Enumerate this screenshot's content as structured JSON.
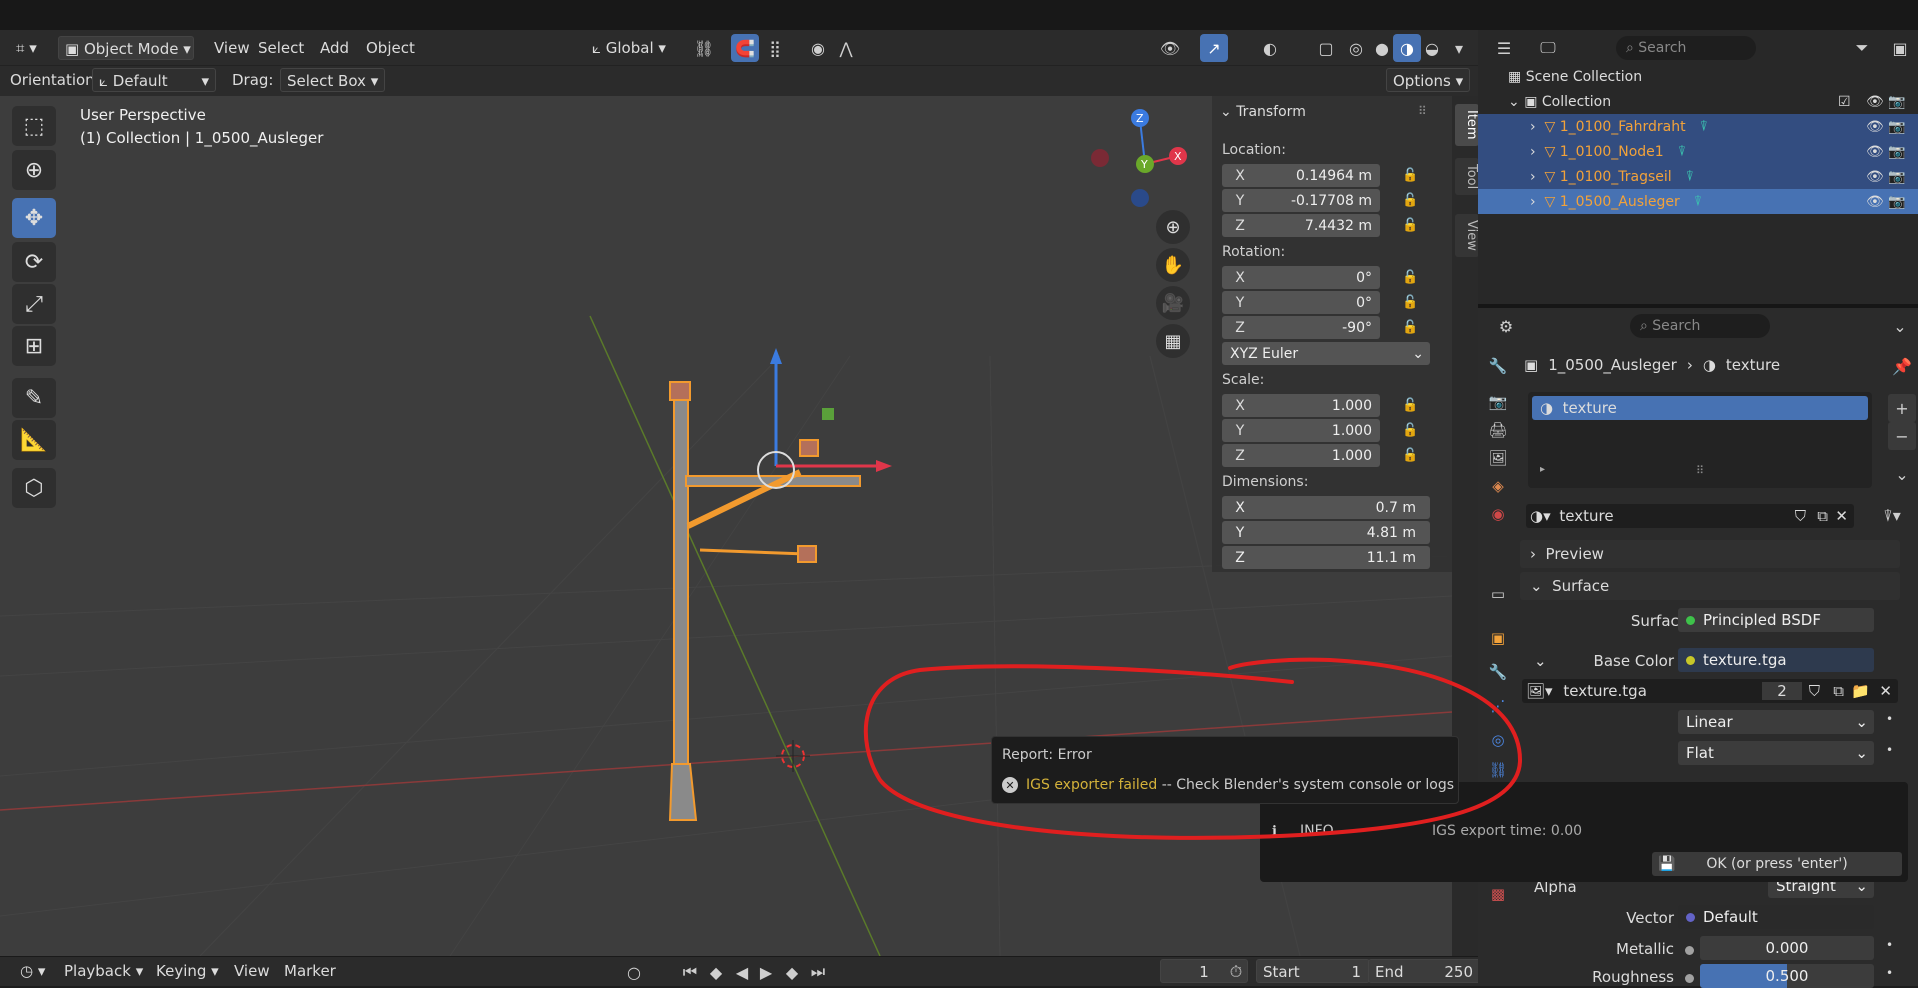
{
  "colors": {
    "accent": "#4772b3",
    "object_orange": "#f2a23a",
    "error_yellow": "#d4b23a",
    "annotation_red": "#e01f1f"
  },
  "header": {
    "editor_type_icon": "grid-icon",
    "mode": "Object Mode",
    "menus": [
      "View",
      "Select",
      "Add",
      "Object"
    ],
    "transform_orientation": "Global",
    "shading_icons": [
      "wireframe-icon",
      "solid-icon",
      "material-icon",
      "rendered-icon"
    ]
  },
  "tool_header": {
    "orientation_label": "Orientation:",
    "orientation_value": "Default",
    "drag_label": "Drag:",
    "drag_value": "Select Box",
    "options_label": "Options"
  },
  "viewport": {
    "perspective": "User Perspective",
    "context": "(1) Collection | 1_0500_Ausleger",
    "gizmo_axes": [
      "X",
      "Y",
      "Z"
    ]
  },
  "npanel": {
    "tabs": [
      "Item",
      "Tool",
      "View"
    ],
    "panel_title": "Transform",
    "location_label": "Location:",
    "location": [
      {
        "axis": "X",
        "value": "0.14964 m"
      },
      {
        "axis": "Y",
        "value": "-0.17708 m"
      },
      {
        "axis": "Z",
        "value": "7.4432 m"
      }
    ],
    "rotation_label": "Rotation:",
    "rotation": [
      {
        "axis": "X",
        "value": "0°"
      },
      {
        "axis": "Y",
        "value": "0°"
      },
      {
        "axis": "Z",
        "value": "-90°"
      }
    ],
    "rotation_mode": "XYZ Euler",
    "scale_label": "Scale:",
    "scale": [
      {
        "axis": "X",
        "value": "1.000"
      },
      {
        "axis": "Y",
        "value": "1.000"
      },
      {
        "axis": "Z",
        "value": "1.000"
      }
    ],
    "dimensions_label": "Dimensions:",
    "dimensions": [
      {
        "axis": "X",
        "value": "0.7 m"
      },
      {
        "axis": "Y",
        "value": "4.81 m"
      },
      {
        "axis": "Z",
        "value": "11.1 m"
      }
    ]
  },
  "timeline": {
    "menus": [
      "Playback",
      "Keying",
      "View",
      "Marker"
    ],
    "current_frame": "1",
    "start_label": "Start",
    "start": "1",
    "end_label": "End",
    "end": "250"
  },
  "outliner": {
    "search_placeholder": "Search",
    "scene_collection": "Scene Collection",
    "collection": "Collection",
    "objects": [
      "1_0100_Fahrdraht",
      "1_0100_Node1",
      "1_0100_Tragseil",
      "1_0500_Ausleger"
    ]
  },
  "properties": {
    "search_placeholder": "Search",
    "breadcrumb_object": "1_0500_Ausleger",
    "breadcrumb_material": "texture",
    "material_slot": "texture",
    "material_name": "texture",
    "preview_label": "Preview",
    "surface_panel": "Surface",
    "surface_label": "Surface",
    "surface_value": "Principled BSDF",
    "base_color_label": "Base Color",
    "base_color_value": "texture.tga",
    "image_name": "texture.tga",
    "image_users": "2",
    "interpolation": "Linear",
    "projection": "Flat",
    "alpha_label": "Alpha",
    "alpha_value": "Straight",
    "vector_label": "Vector",
    "vector_value": "Default",
    "metallic_label": "Metallic",
    "metallic_value": "0.000",
    "roughness_label": "Roughness",
    "roughness_value": "0.500",
    "roughness_fraction": 0.5
  },
  "report": {
    "title": "Report: Error",
    "error_highlight": "IGS exporter failed",
    "error_rest": " -- Check Blender's system console or logs"
  },
  "info_popup": {
    "level": "INFO",
    "message": "IGS export time: 0.00",
    "ok_label": "OK (or press 'enter')"
  }
}
